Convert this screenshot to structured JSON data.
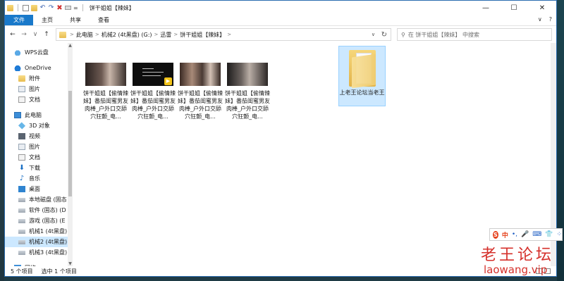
{
  "titlebar": {
    "title": "饼干姐姐【辣妹】",
    "qa_dropdown": "=",
    "buttons": {
      "minimize": "—",
      "maximize": "☐",
      "close": "✕"
    }
  },
  "ribbon": {
    "tabs": [
      "文件",
      "主页",
      "共享",
      "查看"
    ],
    "expand": "∨",
    "help": "?"
  },
  "addressbar": {
    "back": "←",
    "forward": "→",
    "recent": "∨",
    "up": "↑",
    "crumbs": [
      "此电脑",
      "机械2 (4t黑盘) (G:)",
      "迅雷",
      "饼干姐姐【辣妹】"
    ],
    "dropdown": "∨",
    "refresh": "↻",
    "search_placeholder": "在 饼干姐姐【辣妹】 中搜索"
  },
  "nav": {
    "items": [
      {
        "label": "WPS云盘",
        "icon": "wps-cloud-icon",
        "level": 0
      },
      {
        "label": "OneDrive",
        "icon": "onedrive-icon",
        "level": 0
      },
      {
        "label": "附件",
        "icon": "folder-icon",
        "level": 1
      },
      {
        "label": "图片",
        "icon": "pictures-icon",
        "level": 1
      },
      {
        "label": "文档",
        "icon": "documents-icon",
        "level": 1
      },
      {
        "label": "此电脑",
        "icon": "this-pc-icon",
        "level": 0
      },
      {
        "label": "3D 对象",
        "icon": "3d-objects-icon",
        "level": 1
      },
      {
        "label": "视频",
        "icon": "videos-icon",
        "level": 1
      },
      {
        "label": "图片",
        "icon": "pictures-icon",
        "level": 1
      },
      {
        "label": "文档",
        "icon": "documents-icon",
        "level": 1
      },
      {
        "label": "下载",
        "icon": "downloads-icon",
        "level": 1
      },
      {
        "label": "音乐",
        "icon": "music-icon",
        "level": 1
      },
      {
        "label": "桌面",
        "icon": "desktop-icon",
        "level": 1
      },
      {
        "label": "本地磁盘 (固态",
        "icon": "drive-icon",
        "level": 1
      },
      {
        "label": "软件 (固态) (D",
        "icon": "drive-icon",
        "level": 1
      },
      {
        "label": "游戏 (固态) (E",
        "icon": "drive-icon",
        "level": 1
      },
      {
        "label": "机械1 (4t黑盘)",
        "icon": "drive-icon",
        "level": 1
      },
      {
        "label": "机械2 (4t黑盘)",
        "icon": "drive-icon",
        "level": 1,
        "selected": true
      },
      {
        "label": "机械3 (4t黑盘)",
        "icon": "drive-icon",
        "level": 1
      },
      {
        "label": "网络",
        "icon": "network-icon",
        "level": 0
      }
    ]
  },
  "files": [
    {
      "name": "饼干姐姐【偷情辣妹】番茄闺蜜男友肉棒_户外口交舔穴狂颤_电...",
      "thumb": "t1"
    },
    {
      "name": "饼干姐姐【偷情辣妹】番茄闺蜜男友肉棒_户外口交舔穴狂颤_电...",
      "thumb": "t2"
    },
    {
      "name": "饼干姐姐【偷情辣妹】番茄闺蜜男友肉棒_户外口交舔穴狂颤_电...",
      "thumb": "t3"
    },
    {
      "name": "饼干姐姐【偷情辣妹】番茄闺蜜男友肉棒_户外口交舔穴狂颤_电...",
      "thumb": "t4"
    }
  ],
  "folder": {
    "name": "上老王论坛当老王"
  },
  "status": {
    "count": "5 个项目",
    "selected": "选中 1 个项目"
  },
  "ime": {
    "logo": "S",
    "mode": "中",
    "punct": "•,",
    "mic": "🎤",
    "kbd": "⌨",
    "skin": "👕",
    "tools": "⁘"
  },
  "watermark": {
    "line1": "老王论坛",
    "line2": "laowang.vip"
  }
}
